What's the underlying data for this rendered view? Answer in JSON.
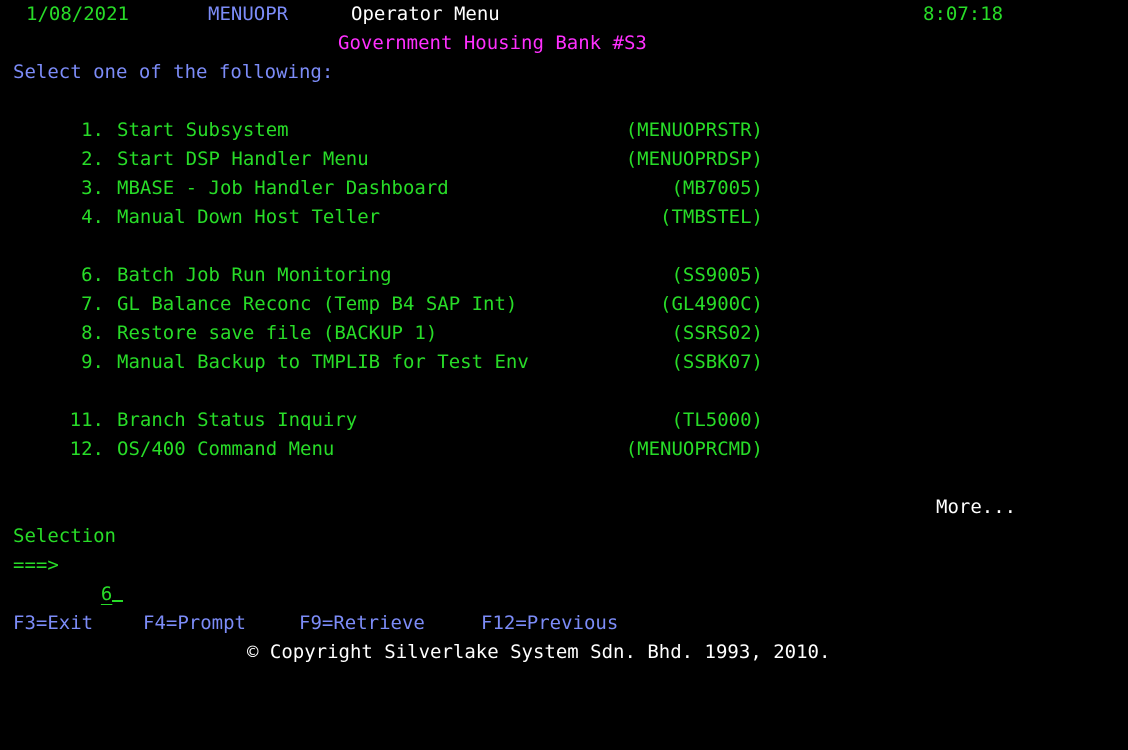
{
  "header": {
    "date": "1/08/2021",
    "menu_id": "MENUOPR",
    "title": "Operator Menu",
    "time": "8:07:18",
    "subtitle": "Government Housing Bank #S3"
  },
  "instruction": "Select one of the following:",
  "menu_items": [
    {
      "number": "1.",
      "label": "Start Subsystem",
      "program": "(MENUOPRSTR)"
    },
    {
      "number": "2.",
      "label": "Start DSP Handler Menu",
      "program": "(MENUOPRDSP)"
    },
    {
      "number": "3.",
      "label": "MBASE - Job Handler Dashboard",
      "program": "(MB7005)"
    },
    {
      "number": "4.",
      "label": "Manual Down Host Teller",
      "program": "(TMBSTEL)"
    },
    {
      "number": "6.",
      "label": "Batch Job Run Monitoring",
      "program": "(SS9005)"
    },
    {
      "number": "7.",
      "label": "GL Balance Reconc (Temp B4 SAP Int)",
      "program": "(GL4900C)"
    },
    {
      "number": "8.",
      "label": "Restore save file (BACKUP 1)",
      "program": "(SSRS02)"
    },
    {
      "number": "9.",
      "label": "Manual Backup to TMPLIB for Test Env",
      "program": "(SSBK07)"
    },
    {
      "number": "11.",
      "label": "Branch Status Inquiry",
      "program": "(TL5000)"
    },
    {
      "number": "12.",
      "label": "OS/400 Command Menu",
      "program": "(MENUOPRCMD)"
    }
  ],
  "more_indicator": "More...",
  "selection": {
    "label": "Selection",
    "prompt": "===>",
    "value": "6"
  },
  "function_keys": [
    {
      "label": "F3=Exit"
    },
    {
      "label": "F4=Prompt"
    },
    {
      "label": "F9=Retrieve"
    },
    {
      "label": "F12=Previous"
    }
  ],
  "copyright": "© Copyright Silverlake System Sdn. Bhd. 1993, 2010.",
  "colors": {
    "background": "#000000",
    "green": "#28dc28",
    "blue": "#7c8cf8",
    "white": "#ffffff",
    "pink": "#ff30ff"
  }
}
